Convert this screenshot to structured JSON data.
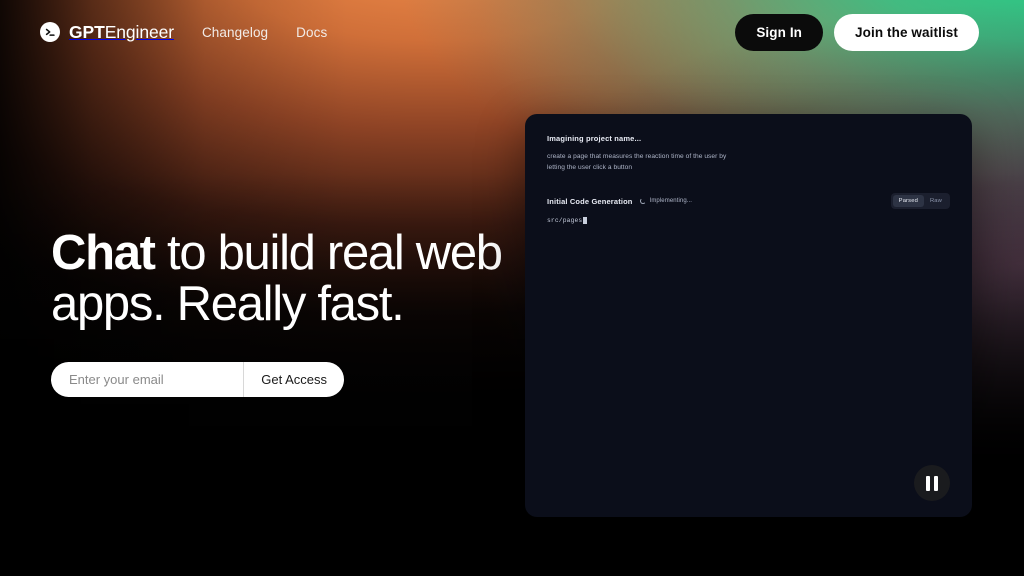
{
  "header": {
    "brand": {
      "bold": "GPT",
      "regular": "Engineer",
      "icon": "terminal-prompt-icon"
    },
    "nav": [
      {
        "label": "Changelog"
      },
      {
        "label": "Docs"
      }
    ],
    "sign_in_label": "Sign In",
    "waitlist_label": "Join the waitlist"
  },
  "hero": {
    "headline_strong": "Chat",
    "headline_rest": " to build real web apps. Really fast.",
    "email_placeholder": "Enter your email",
    "email_value": "",
    "cta_label": "Get Access"
  },
  "demo": {
    "title": "Imagining project name...",
    "prompt": "create a page that measures the reaction time of the user by letting the user click a button",
    "section_title": "Initial Code Generation",
    "status_text": "Implementing...",
    "toggle": {
      "parsed_label": "Parsed",
      "raw_label": "Raw",
      "selected": "Parsed"
    },
    "file_path": "src/pages",
    "pause_icon": "pause-icon"
  },
  "colors": {
    "orange": "#ec7e40",
    "green": "#28d68c",
    "purple": "#966c8c",
    "panel_bg": "#0b0e1a",
    "dark_button": "#0b0b0b",
    "light_button": "#ffffff"
  }
}
